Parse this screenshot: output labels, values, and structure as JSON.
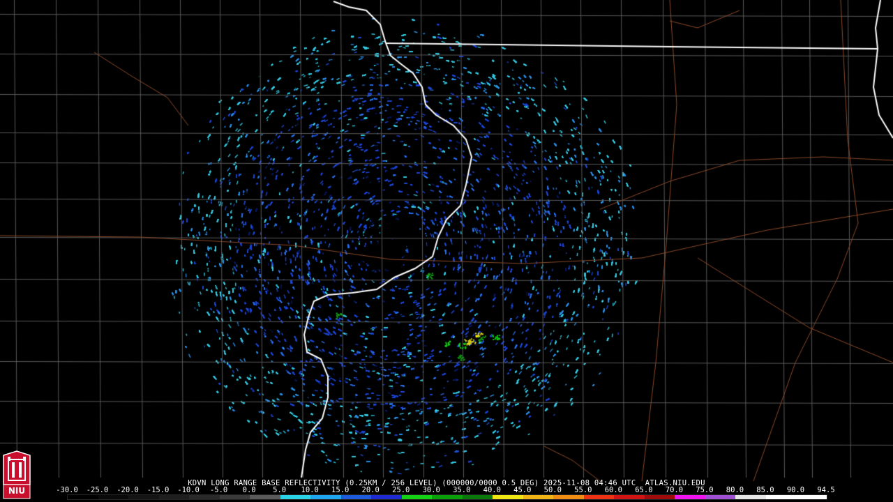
{
  "title": "KDVN LONG RANGE BASE REFLECTIVITY (0.25KM / 256 LEVEL) (000000/0000 0.5 DEG) 2025-11-08 04:46 UTC  ATLAS.NIU.EDU",
  "logo": {
    "name": "niu-logo",
    "text": "NIU",
    "color": "#c8102e"
  },
  "colors": {
    "background": "#000000",
    "county_lines": "#5a5a5a",
    "highways": "#8b4a2a",
    "state_lines": "#ffffff",
    "radar_light": "#37c8e0",
    "radar_deep": "#1e46d2"
  },
  "scale": {
    "labels": [
      "-30.0",
      "-25.0",
      "-20.0",
      "-15.0",
      "-10.0",
      "-5.0",
      "0.0",
      "5.0",
      "10.0",
      "15.0",
      "20.0",
      "25.0",
      "30.0",
      "35.0",
      "40.0",
      "45.0",
      "50.0",
      "55.0",
      "60.0",
      "65.0",
      "70.0",
      "75.0",
      "80.0",
      "85.0",
      "90.0",
      "94.5"
    ],
    "colors": [
      "#000000",
      "#0a0a0a",
      "#141414",
      "#1e1e1e",
      "#2a2a2a",
      "#3a3a3a",
      "#5a5a5a",
      "#2bd3e6",
      "#1ea6f0",
      "#1e5adc",
      "#1e2ad2",
      "#14d214",
      "#0aa00a",
      "#0a780a",
      "#f0e614",
      "#f0b414",
      "#f08c14",
      "#f03214",
      "#d21414",
      "#a00a0a",
      "#f014f0",
      "#a050d2",
      "#e6e6e6",
      "#ffffff",
      "#ffffff"
    ]
  }
}
